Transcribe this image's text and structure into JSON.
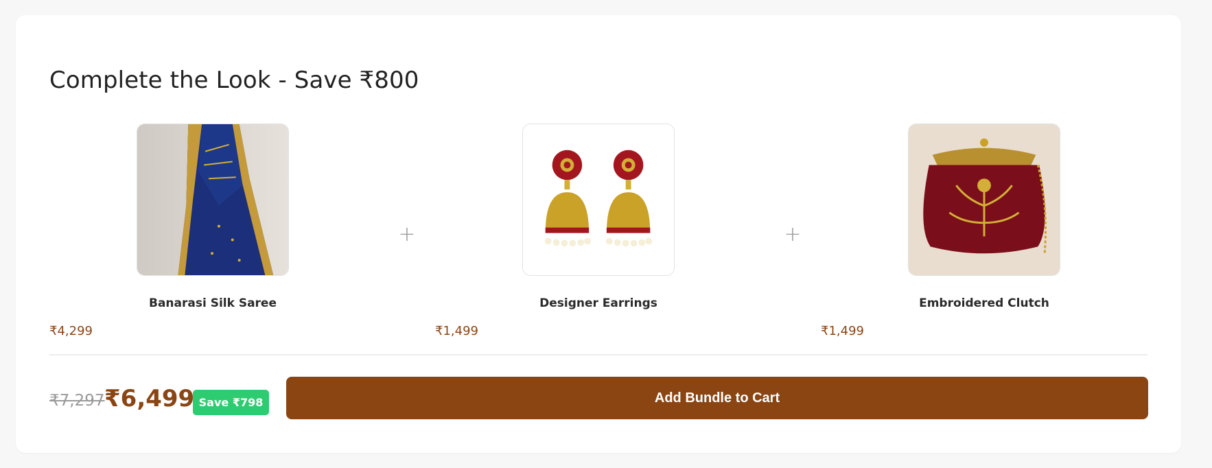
{
  "bundle": {
    "title": "Complete the Look - Save ₹800",
    "products": [
      {
        "name": "Banarasi Silk Saree",
        "price": "₹4,299",
        "image_icon": "saree-image"
      },
      {
        "name": "Designer Earrings",
        "price": "₹1,499",
        "image_icon": "earrings-image"
      },
      {
        "name": "Embroidered Clutch",
        "price": "₹1,499",
        "image_icon": "clutch-image"
      }
    ],
    "separator": "+",
    "original_total": "₹7,297",
    "bundle_total": "₹6,499",
    "savings_badge": "Save ₹798",
    "add_button_label": "Add Bundle to Cart"
  },
  "colors": {
    "accent": "#8b4513",
    "savings_green": "#2ecc71",
    "muted_text": "#9a9a9a"
  }
}
